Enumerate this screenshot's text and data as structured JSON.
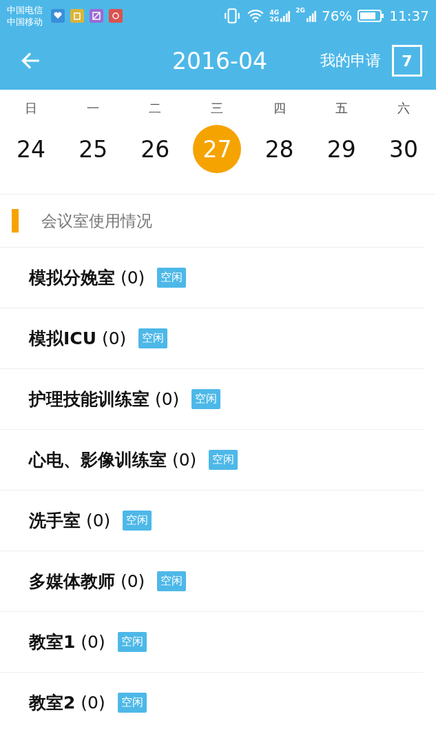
{
  "status_bar": {
    "carriers": [
      "中国电信",
      "中国移动"
    ],
    "network_labels": [
      "4G",
      "2G",
      "2G"
    ],
    "battery_text": "76%",
    "time": "11:37"
  },
  "header": {
    "title": "2016-04",
    "action": "我的申请",
    "calendar_day": "7"
  },
  "week": [
    {
      "weekday": "日",
      "date": "24",
      "selected": false
    },
    {
      "weekday": "一",
      "date": "25",
      "selected": false
    },
    {
      "weekday": "二",
      "date": "26",
      "selected": false
    },
    {
      "weekday": "三",
      "date": "27",
      "selected": true
    },
    {
      "weekday": "四",
      "date": "28",
      "selected": false
    },
    {
      "weekday": "五",
      "date": "29",
      "selected": false
    },
    {
      "weekday": "六",
      "date": "30",
      "selected": false
    }
  ],
  "section": {
    "title": "会议室使用情况"
  },
  "rooms": [
    {
      "name": "模拟分娩室",
      "count": "(0)",
      "status": "空闲"
    },
    {
      "name": "模拟ICU",
      "count": "(0)",
      "status": "空闲"
    },
    {
      "name": "护理技能训练室",
      "count": "(0)",
      "status": "空闲"
    },
    {
      "name": "心电、影像训练室",
      "count": "(0)",
      "status": "空闲"
    },
    {
      "name": "洗手室",
      "count": "(0)",
      "status": "空闲"
    },
    {
      "name": "多媒体教师",
      "count": "(0)",
      "status": "空闲"
    },
    {
      "name": "教室1",
      "count": "(0)",
      "status": "空闲"
    },
    {
      "name": "教室2",
      "count": "(0)",
      "status": "空闲"
    }
  ]
}
